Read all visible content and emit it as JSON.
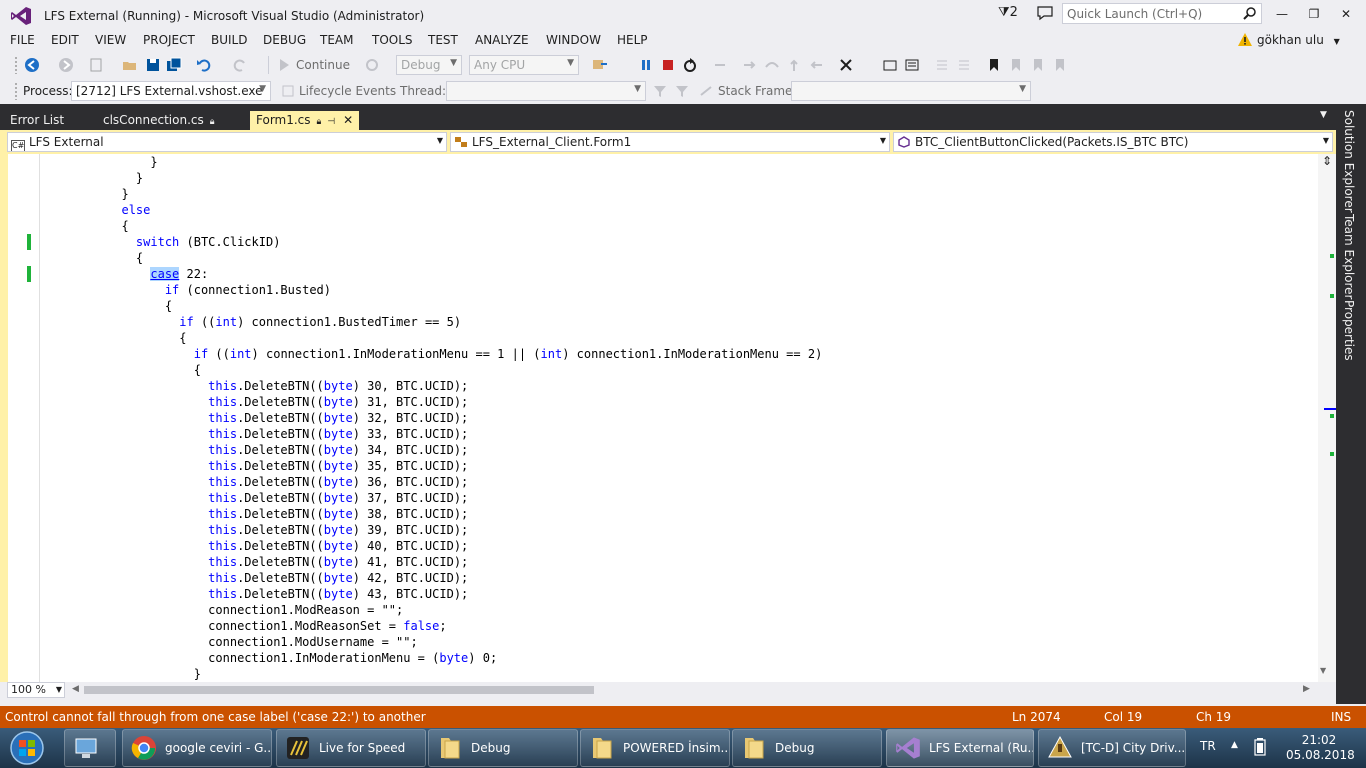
{
  "window": {
    "title": "LFS External (Running) - Microsoft Visual Studio (Administrator)",
    "notifications": "2",
    "quick_launch_placeholder": "Quick Launch (Ctrl+Q)",
    "minimize": "—",
    "maximize": "❐",
    "close": "✕"
  },
  "menu": [
    "FILE",
    "EDIT",
    "VIEW",
    "PROJECT",
    "BUILD",
    "DEBUG",
    "TEAM",
    "TOOLS",
    "TEST",
    "ANALYZE",
    "WINDOW",
    "HELP"
  ],
  "user": {
    "name": "gökhan ulu"
  },
  "toolbar": {
    "continue_label": "Continue",
    "config": "Debug",
    "platform": "Any CPU",
    "process_label": "Process:",
    "process_value": "[2712] LFS External.vshost.exe",
    "lifecycle_label": "Lifecycle Events",
    "thread_label": "Thread:",
    "stackframe_label": "Stack Frame:"
  },
  "tabs": [
    {
      "label": "Error List",
      "active": false
    },
    {
      "label": "clsConnection.cs",
      "active": false
    },
    {
      "label": "Form1.cs",
      "active": true
    }
  ],
  "nav": {
    "project": "LFS External",
    "project_icon": "C#",
    "class": "LFS_External_Client.Form1",
    "member": "BTC_ClientButtonClicked(Packets.IS_BTC BTC)"
  },
  "code_lines": [
    {
      "indent": 15,
      "parts": [
        [
          "t",
          "}"
        ]
      ]
    },
    {
      "indent": 13,
      "parts": [
        [
          "t",
          "}"
        ]
      ]
    },
    {
      "indent": 11,
      "parts": [
        [
          "t",
          "}"
        ]
      ]
    },
    {
      "indent": 11,
      "parts": [
        [
          "k",
          "else"
        ]
      ]
    },
    {
      "indent": 11,
      "parts": [
        [
          "t",
          "{"
        ]
      ]
    },
    {
      "indent": 13,
      "parts": [
        [
          "k",
          "switch"
        ],
        [
          "t",
          " (BTC.ClickID)"
        ]
      ]
    },
    {
      "indent": 13,
      "parts": [
        [
          "t",
          "{"
        ]
      ]
    },
    {
      "indent": 15,
      "parts": [
        [
          "s",
          "case"
        ],
        [
          "t",
          " 22:"
        ]
      ]
    },
    {
      "indent": 17,
      "parts": [
        [
          "k",
          "if"
        ],
        [
          "t",
          " (connection1.Busted)"
        ]
      ]
    },
    {
      "indent": 17,
      "parts": [
        [
          "t",
          "{"
        ]
      ]
    },
    {
      "indent": 19,
      "parts": [
        [
          "k",
          "if"
        ],
        [
          "t",
          " (("
        ],
        [
          "k",
          "int"
        ],
        [
          "t",
          ") connection1.BustedTimer == 5)"
        ]
      ]
    },
    {
      "indent": 19,
      "parts": [
        [
          "t",
          "{"
        ]
      ]
    },
    {
      "indent": 21,
      "parts": [
        [
          "k",
          "if"
        ],
        [
          "t",
          " (("
        ],
        [
          "k",
          "int"
        ],
        [
          "t",
          ") connection1.InModerationMenu == 1 || ("
        ],
        [
          "k",
          "int"
        ],
        [
          "t",
          ") connection1.InModerationMenu == 2)"
        ]
      ]
    },
    {
      "indent": 21,
      "parts": [
        [
          "t",
          "{"
        ]
      ]
    },
    {
      "indent": 23,
      "parts": [
        [
          "k",
          "this"
        ],
        [
          "t",
          ".DeleteBTN(("
        ],
        [
          "k",
          "byte"
        ],
        [
          "t",
          ") 30, BTC.UCID);"
        ]
      ]
    },
    {
      "indent": 23,
      "parts": [
        [
          "k",
          "this"
        ],
        [
          "t",
          ".DeleteBTN(("
        ],
        [
          "k",
          "byte"
        ],
        [
          "t",
          ") 31, BTC.UCID);"
        ]
      ]
    },
    {
      "indent": 23,
      "parts": [
        [
          "k",
          "this"
        ],
        [
          "t",
          ".DeleteBTN(("
        ],
        [
          "k",
          "byte"
        ],
        [
          "t",
          ") 32, BTC.UCID);"
        ]
      ]
    },
    {
      "indent": 23,
      "parts": [
        [
          "k",
          "this"
        ],
        [
          "t",
          ".DeleteBTN(("
        ],
        [
          "k",
          "byte"
        ],
        [
          "t",
          ") 33, BTC.UCID);"
        ]
      ]
    },
    {
      "indent": 23,
      "parts": [
        [
          "k",
          "this"
        ],
        [
          "t",
          ".DeleteBTN(("
        ],
        [
          "k",
          "byte"
        ],
        [
          "t",
          ") 34, BTC.UCID);"
        ]
      ]
    },
    {
      "indent": 23,
      "parts": [
        [
          "k",
          "this"
        ],
        [
          "t",
          ".DeleteBTN(("
        ],
        [
          "k",
          "byte"
        ],
        [
          "t",
          ") 35, BTC.UCID);"
        ]
      ]
    },
    {
      "indent": 23,
      "parts": [
        [
          "k",
          "this"
        ],
        [
          "t",
          ".DeleteBTN(("
        ],
        [
          "k",
          "byte"
        ],
        [
          "t",
          ") 36, BTC.UCID);"
        ]
      ]
    },
    {
      "indent": 23,
      "parts": [
        [
          "k",
          "this"
        ],
        [
          "t",
          ".DeleteBTN(("
        ],
        [
          "k",
          "byte"
        ],
        [
          "t",
          ") 37, BTC.UCID);"
        ]
      ]
    },
    {
      "indent": 23,
      "parts": [
        [
          "k",
          "this"
        ],
        [
          "t",
          ".DeleteBTN(("
        ],
        [
          "k",
          "byte"
        ],
        [
          "t",
          ") 38, BTC.UCID);"
        ]
      ]
    },
    {
      "indent": 23,
      "parts": [
        [
          "k",
          "this"
        ],
        [
          "t",
          ".DeleteBTN(("
        ],
        [
          "k",
          "byte"
        ],
        [
          "t",
          ") 39, BTC.UCID);"
        ]
      ]
    },
    {
      "indent": 23,
      "parts": [
        [
          "k",
          "this"
        ],
        [
          "t",
          ".DeleteBTN(("
        ],
        [
          "k",
          "byte"
        ],
        [
          "t",
          ") 40, BTC.UCID);"
        ]
      ]
    },
    {
      "indent": 23,
      "parts": [
        [
          "k",
          "this"
        ],
        [
          "t",
          ".DeleteBTN(("
        ],
        [
          "k",
          "byte"
        ],
        [
          "t",
          ") 41, BTC.UCID);"
        ]
      ]
    },
    {
      "indent": 23,
      "parts": [
        [
          "k",
          "this"
        ],
        [
          "t",
          ".DeleteBTN(("
        ],
        [
          "k",
          "byte"
        ],
        [
          "t",
          ") 42, BTC.UCID);"
        ]
      ]
    },
    {
      "indent": 23,
      "parts": [
        [
          "k",
          "this"
        ],
        [
          "t",
          ".DeleteBTN(("
        ],
        [
          "k",
          "byte"
        ],
        [
          "t",
          ") 43, BTC.UCID);"
        ]
      ]
    },
    {
      "indent": 23,
      "parts": [
        [
          "t",
          "connection1.ModReason = \"\";"
        ]
      ]
    },
    {
      "indent": 23,
      "parts": [
        [
          "t",
          "connection1.ModReasonSet = "
        ],
        [
          "k",
          "false"
        ],
        [
          "t",
          ";"
        ]
      ]
    },
    {
      "indent": 23,
      "parts": [
        [
          "t",
          "connection1.ModUsername = \"\";"
        ]
      ]
    },
    {
      "indent": 23,
      "parts": [
        [
          "t",
          "connection1.InModerationMenu = ("
        ],
        [
          "k",
          "byte"
        ],
        [
          "t",
          ") 0;"
        ]
      ]
    },
    {
      "indent": 21,
      "parts": [
        [
          "t",
          "}"
        ]
      ]
    }
  ],
  "editor": {
    "zoom": "100 %",
    "split_glyph": "⇕"
  },
  "right_dock": [
    "Solution Explorer",
    "Team Explorer",
    "Properties"
  ],
  "status": {
    "message": "Control cannot fall through from one case label ('case 22:') to another",
    "line": "Ln 2074",
    "col": "Col 19",
    "ch": "Ch 19",
    "mode": "INS",
    "bar_color": "#ca5100"
  },
  "taskbar": {
    "items": [
      {
        "label": "",
        "icon": "computer-icon",
        "pinned": true
      },
      {
        "label": "google ceviri - G...",
        "icon": "chrome-icon"
      },
      {
        "label": "Live for Speed",
        "icon": "lfs-icon"
      },
      {
        "label": "Debug",
        "icon": "folder-icon"
      },
      {
        "label": "POWERED İnsim...",
        "icon": "folder-icon"
      },
      {
        "label": "Debug",
        "icon": "folder-icon"
      },
      {
        "label": "LFS External (Ru...",
        "icon": "visual-studio-icon",
        "active": true
      },
      {
        "label": "[TC-D] City Driv...",
        "icon": "app-icon"
      }
    ],
    "lang": "TR",
    "time": "21:02",
    "date": "05.08.2018"
  }
}
